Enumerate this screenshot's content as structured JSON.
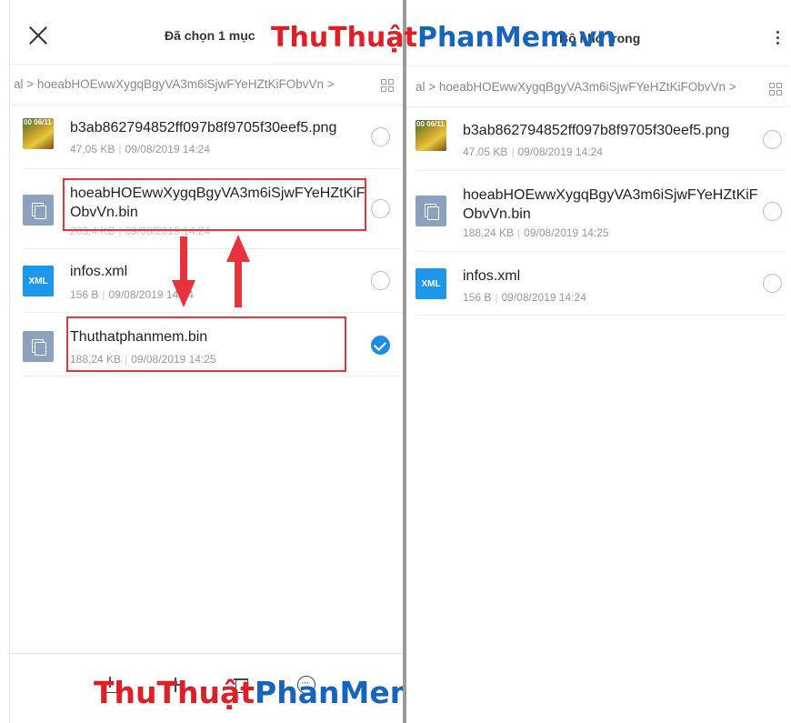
{
  "left_panel": {
    "title": "Đã chọn 1 mục",
    "breadcrumb": "al > hoeabHOEwwXygqBgyVA3m6iSjwFYeHZtKiFObvVn >",
    "files": [
      {
        "name": "b3ab862794852ff097b8f9705f30eef5.png",
        "size": "47,05 KB",
        "date": "09/08/2019 14:24",
        "icon": "image-thumbnail",
        "thumb_text": "00 06/11",
        "selected": false
      },
      {
        "name": "hoeabHOEwwXygqBgyVA3m6iSjwFYeHZtKiFObvVn.bin",
        "size": "203,4 KB",
        "date": "09/08/2019 14:24",
        "icon": "file-copy-icon",
        "selected": false
      },
      {
        "name": "infos.xml",
        "size": "156 B",
        "date": "09/08/2019 14:24",
        "icon": "xml-icon",
        "icon_label": "XML",
        "selected": false
      },
      {
        "name": "Thuthatphanmem.bin",
        "size": "188,24 KB",
        "date": "09/08/2019 14:25",
        "icon": "file-copy-icon",
        "selected": true
      }
    ],
    "bottom_actions": [
      "share-icon",
      "move-icon",
      "delete-icon",
      "more-icon"
    ]
  },
  "right_panel": {
    "title": "Bộ nhớ trong",
    "breadcrumb": "al > hoeabHOEwwXygqBgyVA3m6iSjwFYeHZtKiFObvVn >",
    "files": [
      {
        "name": "b3ab862794852ff097b8f9705f30eef5.png",
        "size": "47,05 KB",
        "date": "09/08/2019 14:24",
        "icon": "image-thumbnail",
        "thumb_text": "00 06/11",
        "selected": false
      },
      {
        "name": "hoeabHOEwwXygqBgyVA3m6iSjwFYeHZtKiFObvVn.bin",
        "size": "188,24 KB",
        "date": "09/08/2019 14:25",
        "icon": "file-copy-icon",
        "selected": false
      },
      {
        "name": "infos.xml",
        "size": "156 B",
        "date": "09/08/2019 14:24",
        "icon": "xml-icon",
        "icon_label": "XML",
        "selected": false
      }
    ]
  },
  "watermark": {
    "part1": "ThuThuật",
    "part2": "PhanMem",
    "part3": ".vn"
  },
  "colors": {
    "accent": "#1a8ce8",
    "highlight": "#e8323c",
    "watermark_red": "#e01e25",
    "watermark_blue": "#1565c0"
  }
}
